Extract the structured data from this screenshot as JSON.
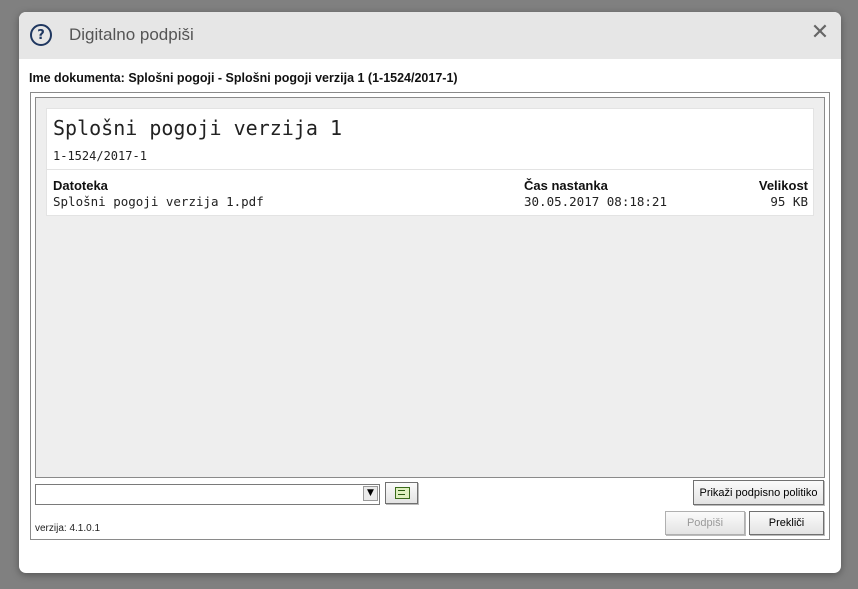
{
  "dialog": {
    "title": "Digitalno podpiši",
    "help_icon_glyph": "?",
    "close_icon_glyph": "✕"
  },
  "document": {
    "name_label": "Ime dokumenta: Splošni pogoji - Splošni pogoji verzija 1 (1-1524/2017-1)",
    "title": "Splošni pogoji verzija 1",
    "id": "1-1524/2017-1"
  },
  "table": {
    "columns": [
      "Datoteka",
      "Čas nastanka",
      "Velikost"
    ],
    "rows": [
      {
        "file": "Splošni pogoji verzija 1.pdf",
        "created": "30.05.2017 08:18:21",
        "size": "95 KB"
      }
    ]
  },
  "controls": {
    "certificate_select_value": "",
    "certificate_button_icon": "certificate-icon",
    "show_policy_label": "Prikaži podpisno politiko",
    "sign_label": "Podpiši",
    "cancel_label": "Prekliči"
  },
  "footer": {
    "version": "verzija: 4.1.0.1"
  },
  "colors": {
    "backdrop": "#808080",
    "titlebar": "#e6e6e6",
    "help_icon": "#1f3760"
  }
}
